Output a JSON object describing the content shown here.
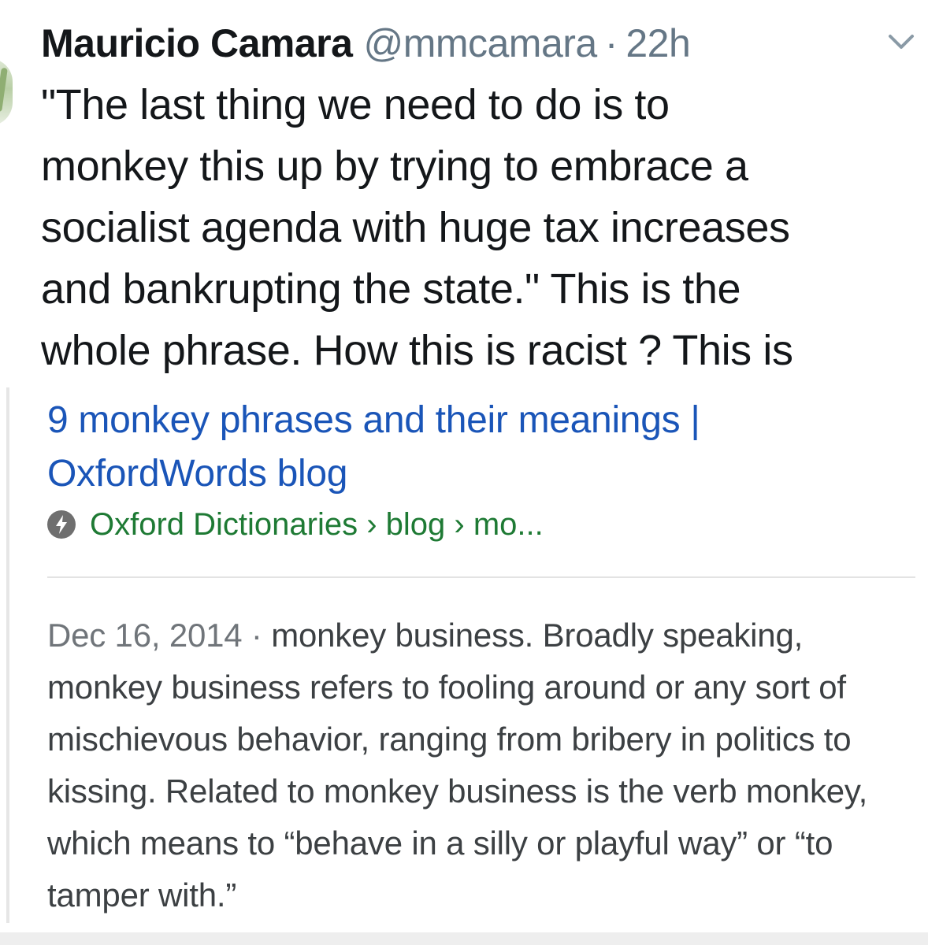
{
  "tweet": {
    "author_name": "Mauricio Camara",
    "author_handle": "@mmcamara",
    "separator": "·",
    "timestamp": "22h",
    "text": "\"The last thing we need to do is to\nmonkey this up by trying to embrace a\nsocialist agenda with huge tax increases\nand bankrupting the state.\" This is the\nwhole phrase. How this is racist ? This is"
  },
  "card": {
    "title": "9 monkey phrases and their meanings |\nOxfordWords blog",
    "source": "Oxford Dictionaries › blog › mo...",
    "snippet_date": "Dec 16, 2014",
    "snippet_sep": " · ",
    "snippet_text": "monkey business. Broadly speaking, monkey business refers to fooling around or any sort of mischievous behavior, ranging from bribery in politics to kissing. Related to monkey business is the verb monkey, which means to “behave in a silly or playful way” or “to tamper with.”"
  },
  "colors": {
    "link_blue": "#1a55b8",
    "source_green": "#1e7a34",
    "secondary_gray": "#657786",
    "text_dark": "#14171a"
  },
  "icons": {
    "menu": "chevron-down-icon",
    "amp": "lightning-bolt-icon"
  }
}
